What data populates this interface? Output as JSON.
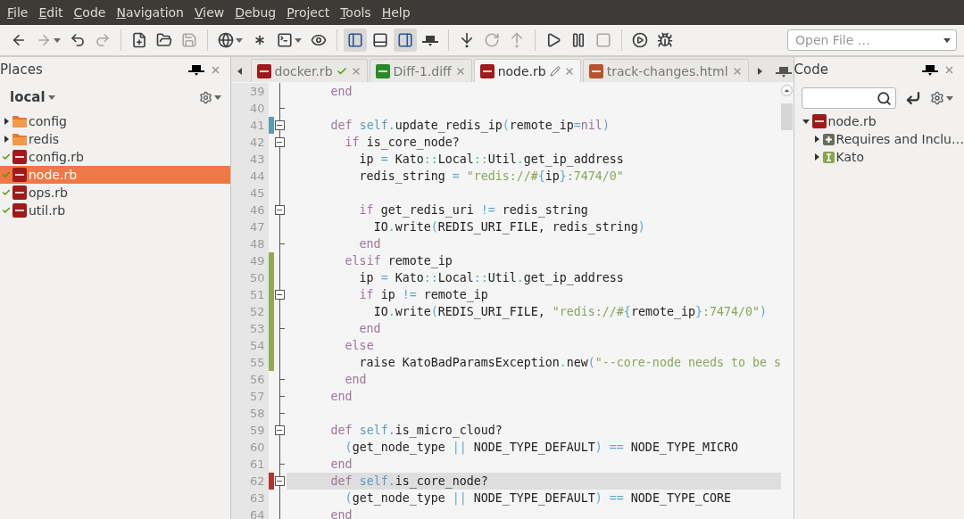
{
  "menu": [
    "File",
    "Edit",
    "Code",
    "Navigation",
    "View",
    "Debug",
    "Project",
    "Tools",
    "Help"
  ],
  "toolbar": {
    "groups": [
      [
        {
          "kind": "back",
          "disabled": false,
          "selected": false,
          "dropdown": false
        },
        {
          "kind": "forward",
          "disabled": true,
          "selected": false,
          "dropdown": true
        },
        {
          "kind": "undo",
          "disabled": false,
          "selected": false,
          "dropdown": false
        },
        {
          "kind": "redo",
          "disabled": true,
          "selected": false,
          "dropdown": false
        }
      ],
      [
        {
          "kind": "new-file",
          "disabled": false,
          "selected": false,
          "dropdown": false
        },
        {
          "kind": "open-folder",
          "disabled": false,
          "selected": false,
          "dropdown": false
        },
        {
          "kind": "save",
          "disabled": true,
          "selected": false,
          "dropdown": false
        }
      ],
      [
        {
          "kind": "globe",
          "disabled": false,
          "selected": false,
          "dropdown": true
        },
        {
          "kind": "asterisk",
          "disabled": false,
          "selected": false,
          "dropdown": false
        },
        {
          "kind": "terminal",
          "disabled": false,
          "selected": false,
          "dropdown": true
        },
        {
          "kind": "eye",
          "disabled": false,
          "selected": false,
          "dropdown": false
        }
      ],
      [
        {
          "kind": "left-pane",
          "disabled": false,
          "selected": true,
          "dropdown": false
        },
        {
          "kind": "bottom-pane",
          "disabled": false,
          "selected": false,
          "dropdown": false
        },
        {
          "kind": "right-pane",
          "disabled": false,
          "selected": true,
          "dropdown": false
        },
        {
          "kind": "hat",
          "disabled": false,
          "selected": false,
          "dropdown": false
        }
      ],
      [
        {
          "kind": "step-in",
          "disabled": false,
          "selected": false,
          "dropdown": false
        },
        {
          "kind": "step-over",
          "disabled": true,
          "selected": false,
          "dropdown": false
        },
        {
          "kind": "step-out",
          "disabled": true,
          "selected": false,
          "dropdown": false
        }
      ],
      [
        {
          "kind": "play",
          "disabled": false,
          "selected": false,
          "dropdown": false
        },
        {
          "kind": "pause",
          "disabled": false,
          "selected": false,
          "dropdown": false
        },
        {
          "kind": "stop",
          "disabled": true,
          "selected": false,
          "dropdown": false
        }
      ],
      [
        {
          "kind": "run-circle",
          "disabled": false,
          "selected": false,
          "dropdown": false
        },
        {
          "kind": "breakpoint",
          "disabled": false,
          "selected": false,
          "dropdown": false
        }
      ]
    ],
    "open_file": {
      "placeholder": "Open File …"
    }
  },
  "places": {
    "title": "Places",
    "location": "local",
    "items": [
      {
        "kind": "folder",
        "label": "config",
        "expanded": false,
        "committed": false,
        "selected": false
      },
      {
        "kind": "folder",
        "label": "redis",
        "expanded": false,
        "committed": false,
        "selected": false
      },
      {
        "kind": "ruby",
        "label": "config.rb",
        "committed": true,
        "selected": false
      },
      {
        "kind": "ruby",
        "label": "node.rb",
        "committed": true,
        "selected": true
      },
      {
        "kind": "ruby",
        "label": "ops.rb",
        "committed": true,
        "selected": false
      },
      {
        "kind": "ruby",
        "label": "util.rb",
        "committed": true,
        "selected": false
      }
    ]
  },
  "tabs": [
    {
      "label": "docker.rb",
      "kind": "ruby",
      "committed": true,
      "modified": false,
      "selected": false
    },
    {
      "label": "Diff-1.diff",
      "kind": "diff",
      "committed": false,
      "modified": false,
      "selected": false
    },
    {
      "label": "node.rb",
      "kind": "ruby",
      "committed": false,
      "modified": true,
      "selected": true
    },
    {
      "label": "track-changes.html",
      "kind": "html",
      "committed": false,
      "modified": false,
      "selected": false
    }
  ],
  "editor": {
    "lines": [
      {
        "number": "39",
        "foldable": false,
        "fold_end": false,
        "current": false,
        "tokens": [
          {
            "kind": "kw",
            "text": "end"
          }
        ]
      },
      {
        "number": "40",
        "foldable": false,
        "fold_end": true,
        "current": false
      },
      {
        "number": "41",
        "color": "#5b9bb5",
        "foldable": true,
        "fold_end": false,
        "current": false,
        "tokens": [
          {
            "kind": "kw",
            "text": "def "
          },
          {
            "kind": "self",
            "text": "self."
          },
          {
            "kind": "plain",
            "text": "update_redis_ip"
          },
          {
            "kind": "op",
            "text": "("
          },
          {
            "kind": "plain",
            "text": "remote_ip"
          },
          {
            "kind": "op",
            "text": "="
          },
          {
            "kind": "kw",
            "text": "nil"
          },
          {
            "kind": "op",
            "text": ")"
          }
        ],
        "children": [
          {
            "number": "42",
            "foldable": true,
            "fold_end": false,
            "current": false,
            "tokens": [
              {
                "kind": "kw",
                "text": "if "
              },
              {
                "kind": "plain",
                "text": "is_core_node?"
              }
            ],
            "children": [
              {
                "number": "43",
                "foldable": false,
                "fold_end": false,
                "current": false,
                "tokens": [
                  {
                    "kind": "plain",
                    "text": "ip "
                  },
                  {
                    "kind": "op",
                    "text": "= "
                  },
                  {
                    "kind": "plain",
                    "text": "Kato"
                  },
                  {
                    "kind": "op",
                    "text": "::"
                  },
                  {
                    "kind": "plain",
                    "text": "Local"
                  },
                  {
                    "kind": "op",
                    "text": "::"
                  },
                  {
                    "kind": "plain",
                    "text": "Util"
                  },
                  {
                    "kind": "op",
                    "text": "."
                  },
                  {
                    "kind": "plain",
                    "text": "get_ip_address"
                  }
                ]
              },
              {
                "number": "44",
                "foldable": false,
                "fold_end": false,
                "current": false,
                "tokens": [
                  {
                    "kind": "plain",
                    "text": "redis_string "
                  },
                  {
                    "kind": "op",
                    "text": "= "
                  },
                  {
                    "kind": "str",
                    "text": "\"redis://#"
                  },
                  {
                    "kind": "op",
                    "text": "{"
                  },
                  {
                    "kind": "plain",
                    "text": "ip"
                  },
                  {
                    "kind": "op",
                    "text": "}"
                  },
                  {
                    "kind": "str",
                    "text": ":7474/0\""
                  }
                ]
              },
              {
                "number": "45",
                "foldable": false,
                "fold_end": false,
                "current": false
              },
              {
                "number": "46",
                "foldable": true,
                "fold_end": false,
                "current": false,
                "tokens": [
                  {
                    "kind": "kw",
                    "text": "if "
                  },
                  {
                    "kind": "plain",
                    "text": "get_redis_uri "
                  },
                  {
                    "kind": "op",
                    "text": "!= "
                  },
                  {
                    "kind": "plain",
                    "text": "redis_string"
                  }
                ],
                "children": [
                  {
                    "number": "47",
                    "foldable": false,
                    "fold_end": false,
                    "current": false,
                    "tokens": [
                      {
                        "kind": "plain",
                        "text": "IO"
                      },
                      {
                        "kind": "op",
                        "text": "."
                      },
                      {
                        "kind": "plain",
                        "text": "write"
                      },
                      {
                        "kind": "op",
                        "text": "("
                      },
                      {
                        "kind": "plain",
                        "text": "REDIS_URI_FILE, redis_string"
                      },
                      {
                        "kind": "op",
                        "text": ")"
                      }
                    ]
                  }
                ]
              },
              {
                "number": "48",
                "foldable": false,
                "fold_end": true,
                "current": false,
                "tokens": [
                  {
                    "kind": "kw",
                    "text": "end"
                  }
                ]
              }
            ]
          },
          {
            "number": "49",
            "color": "#93a857",
            "foldable": false,
            "fold_end": false,
            "current": false,
            "tokens": [
              {
                "kind": "kw",
                "text": "elsif "
              },
              {
                "kind": "plain",
                "text": "remote_ip"
              }
            ],
            "children": [
              {
                "number": "50",
                "color": "#93a857",
                "foldable": false,
                "fold_end": false,
                "current": false,
                "tokens": [
                  {
                    "kind": "plain",
                    "text": "ip "
                  },
                  {
                    "kind": "op",
                    "text": "= "
                  },
                  {
                    "kind": "plain",
                    "text": "Kato"
                  },
                  {
                    "kind": "op",
                    "text": "::"
                  },
                  {
                    "kind": "plain",
                    "text": "Local"
                  },
                  {
                    "kind": "op",
                    "text": "::"
                  },
                  {
                    "kind": "plain",
                    "text": "Util"
                  },
                  {
                    "kind": "op",
                    "text": "."
                  },
                  {
                    "kind": "plain",
                    "text": "get_ip_address"
                  }
                ]
              },
              {
                "number": "51",
                "color": "#93a857",
                "foldable": true,
                "fold_end": false,
                "current": false,
                "tokens": [
                  {
                    "kind": "kw",
                    "text": "if "
                  },
                  {
                    "kind": "plain",
                    "text": "ip "
                  },
                  {
                    "kind": "op",
                    "text": "!= "
                  },
                  {
                    "kind": "plain",
                    "text": "remote_ip"
                  }
                ],
                "children": [
                  {
                    "number": "52",
                    "color": "#93a857",
                    "foldable": false,
                    "fold_end": false,
                    "current": false,
                    "tokens": [
                      {
                        "kind": "plain",
                        "text": "IO"
                      },
                      {
                        "kind": "op",
                        "text": "."
                      },
                      {
                        "kind": "plain",
                        "text": "write"
                      },
                      {
                        "kind": "op",
                        "text": "("
                      },
                      {
                        "kind": "plain",
                        "text": "REDIS_URI_FILE, "
                      },
                      {
                        "kind": "str",
                        "text": "\"redis://#"
                      },
                      {
                        "kind": "op",
                        "text": "{"
                      },
                      {
                        "kind": "plain",
                        "text": "remote_ip"
                      },
                      {
                        "kind": "op",
                        "text": "}"
                      },
                      {
                        "kind": "str",
                        "text": ":7474/0\""
                      },
                      {
                        "kind": "op",
                        "text": ")"
                      }
                    ]
                  }
                ]
              },
              {
                "number": "53",
                "color": "#93a857",
                "foldable": false,
                "fold_end": true,
                "current": false,
                "tokens": [
                  {
                    "kind": "kw",
                    "text": "end"
                  }
                ]
              }
            ]
          },
          {
            "number": "54",
            "color": "#93a857",
            "foldable": false,
            "fold_end": false,
            "current": false,
            "tokens": [
              {
                "kind": "kw",
                "text": "else"
              }
            ],
            "children": [
              {
                "number": "55",
                "color": "#93a857",
                "foldable": false,
                "fold_end": false,
                "current": false,
                "tokens": [
                  {
                    "kind": "plain",
                    "text": "raise KatoBadParamsException"
                  },
                  {
                    "kind": "op",
                    "text": "."
                  },
                  {
                    "kind": "plain",
                    "text": "new"
                  },
                  {
                    "kind": "op",
                    "text": "("
                  },
                  {
                    "kind": "str",
                    "text": "\"--core-node needs to be s"
                  }
                ]
              }
            ]
          },
          {
            "number": "56",
            "foldable": false,
            "fold_end": true,
            "current": false,
            "tokens": [
              {
                "kind": "kw",
                "text": "end"
              }
            ]
          }
        ]
      },
      {
        "number": "57",
        "foldable": false,
        "fold_end": true,
        "current": false,
        "tokens": [
          {
            "kind": "kw",
            "text": "end"
          }
        ]
      },
      {
        "number": "58",
        "foldable": false,
        "fold_end": true,
        "current": false
      },
      {
        "number": "59",
        "foldable": true,
        "fold_end": false,
        "current": false,
        "tokens": [
          {
            "kind": "kw",
            "text": "def "
          },
          {
            "kind": "self",
            "text": "self."
          },
          {
            "kind": "plain",
            "text": "is_micro_cloud?"
          }
        ],
        "children": [
          {
            "number": "60",
            "foldable": false,
            "fold_end": false,
            "current": false,
            "tokens": [
              {
                "kind": "op",
                "text": "("
              },
              {
                "kind": "plain",
                "text": "get_node_type "
              },
              {
                "kind": "op",
                "text": "|| "
              },
              {
                "kind": "plain",
                "text": "NODE_TYPE_DEFAULT"
              },
              {
                "kind": "op",
                "text": ") == "
              },
              {
                "kind": "plain",
                "text": "NODE_TYPE_MICRO"
              }
            ]
          }
        ]
      },
      {
        "number": "61",
        "foldable": false,
        "fold_end": true,
        "current": false,
        "tokens": [
          {
            "kind": "kw",
            "text": "end"
          }
        ]
      },
      {
        "number": "62",
        "color": "#b23535",
        "foldable": true,
        "fold_end": false,
        "current": true,
        "tokens": [
          {
            "kind": "kw",
            "text": "def "
          },
          {
            "kind": "self",
            "text": "self."
          },
          {
            "kind": "plain",
            "text": "is_core_node?"
          }
        ],
        "children": [
          {
            "number": "63",
            "foldable": false,
            "fold_end": false,
            "current": false,
            "tokens": [
              {
                "kind": "op",
                "text": "("
              },
              {
                "kind": "plain",
                "text": "get_node_type "
              },
              {
                "kind": "op",
                "text": "|| "
              },
              {
                "kind": "plain",
                "text": "NODE_TYPE_DEFAULT"
              },
              {
                "kind": "op",
                "text": ") == "
              },
              {
                "kind": "plain",
                "text": "NODE_TYPE_CORE"
              }
            ]
          }
        ]
      },
      {
        "number": "64",
        "foldable": false,
        "fold_end": false,
        "current": false,
        "tokens": [
          {
            "kind": "kw",
            "text": "end"
          }
        ]
      }
    ]
  },
  "code_panel": {
    "title": "Code",
    "tree": [
      {
        "kind": "ruby",
        "label": "node.rb",
        "expanded": true,
        "children": [
          {
            "kind": "section",
            "label": "Requires and Inclu…",
            "expanded": false
          },
          {
            "kind": "class",
            "label": "Kato",
            "expanded": false
          }
        ]
      }
    ]
  }
}
